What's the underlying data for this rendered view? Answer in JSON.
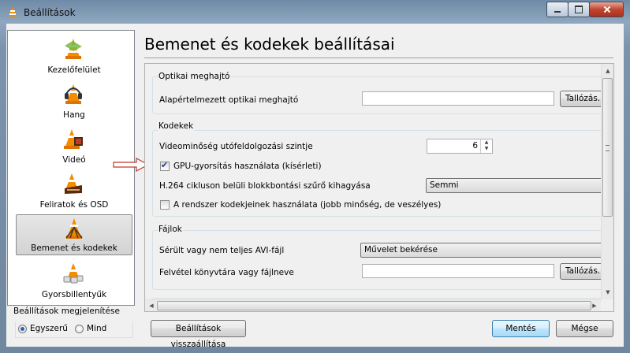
{
  "window": {
    "title": "Beállítások"
  },
  "sidebar": {
    "items": [
      {
        "label": "Kezelőfelület",
        "icon": "vlc-cone-icon"
      },
      {
        "label": "Hang",
        "icon": "headphones-cone-icon"
      },
      {
        "label": "Videó",
        "icon": "film-cone-icon"
      },
      {
        "label": "Feliratok és OSD",
        "icon": "subtitles-cone-icon"
      },
      {
        "label": "Bemenet és kodekek",
        "icon": "input-codecs-cone-icon",
        "selected": true
      },
      {
        "label": "Gyorsbillentyűk",
        "icon": "hotkeys-cone-icon"
      }
    ]
  },
  "show_settings": {
    "title": "Beállítások megjelenítése",
    "options": [
      {
        "label": "Egyszerű",
        "checked": true
      },
      {
        "label": "Mind",
        "checked": false
      }
    ]
  },
  "main": {
    "title": "Bemenet és kodekek beállításai",
    "optical": {
      "title": "Optikai meghajtó",
      "device_label": "Alapértelmezett optikai meghajtó",
      "device_value": "",
      "browse_label": "Tallózás..."
    },
    "codecs": {
      "title": "Kodekek",
      "postproc_label": "Videominőség utófeldolgozási szintje",
      "postproc_value": "6",
      "gpu_label": "GPU-gyorsítás használata (kísérleti)",
      "gpu_checked": true,
      "h264_label": "H.264 cikluson belüli blokkbontási szűrő kihagyása",
      "h264_value": "Semmi",
      "system_codecs_label": "A rendszer kodekjeinek használata (jobb minőség, de veszélyes)",
      "system_codecs_checked": false
    },
    "files": {
      "title": "Fájlok",
      "avi_label": "Sérült vagy nem teljes AVI-fájl",
      "avi_value": "Művelet bekérése",
      "record_label": "Felvétel könyvtára vagy fájlneve",
      "record_value": "",
      "browse_label": "Tallózás..."
    }
  },
  "footer": {
    "reset_label": "Beállítások visszaállítása",
    "save_label": "Mentés",
    "cancel_label": "Mégse"
  },
  "colors": {
    "annotation_arrow": "#c0392b",
    "selection": "#d3d3d3",
    "accent": "#3c7fb1"
  }
}
